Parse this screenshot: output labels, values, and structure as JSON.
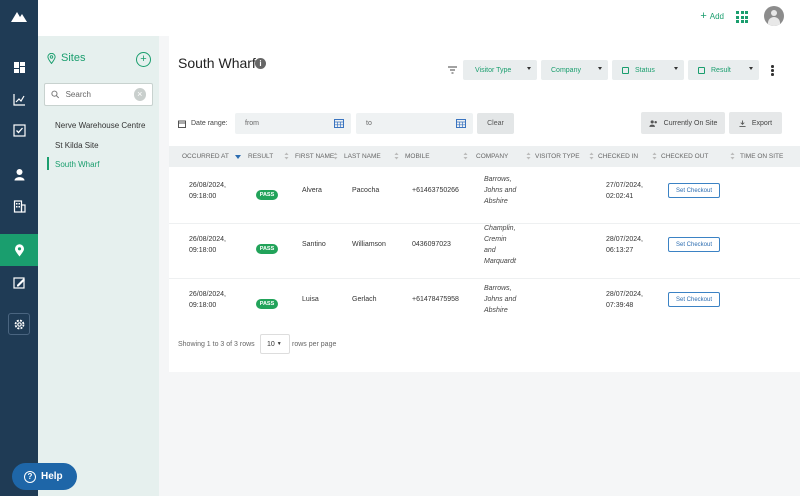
{
  "topbar": {
    "add_label": "Add"
  },
  "sites": {
    "title": "Sites",
    "search_placeholder": "Search",
    "items": [
      "Nerve Warehouse Centre",
      "St Kilda Site",
      "South Wharf"
    ],
    "active_item": "South Wharf"
  },
  "page": {
    "title": "South Wharf",
    "filters": [
      "Visitor Type",
      "Company",
      "Status",
      "Result"
    ],
    "date_range_label": "Date range:",
    "from_placeholder": "from",
    "to_placeholder": "to",
    "clear_label": "Clear",
    "currently_on_site_label": "Currently On Site",
    "export_label": "Export"
  },
  "table": {
    "columns": [
      "OCCURRED AT",
      "RESULT",
      "FIRST NAME",
      "LAST NAME",
      "MOBILE",
      "COMPANY",
      "VISITOR TYPE",
      "CHECKED IN",
      "CHECKED OUT",
      "TIME ON SITE"
    ],
    "rows": [
      {
        "occurred_at": [
          "26/08/2024,",
          "09:18:00"
        ],
        "result": "PASS",
        "first_name": "Alvera",
        "last_name": "Pacocha",
        "mobile": "+61463750266",
        "company": [
          "Barrows,",
          "Johns and",
          "Abshire"
        ],
        "visitor_type": "",
        "checked_in": [
          "27/07/2024,",
          "02:02:41"
        ],
        "checked_out": "Set Checkout",
        "time_on_site": ""
      },
      {
        "occurred_at": [
          "26/08/2024,",
          "09:18:00"
        ],
        "result": "PASS",
        "first_name": "Santino",
        "last_name": "Williamson",
        "mobile": "0436097023",
        "company": [
          "Champlin,",
          "Cremin",
          "and",
          "Marquardt"
        ],
        "visitor_type": "",
        "checked_in": [
          "28/07/2024,",
          "06:13:27"
        ],
        "checked_out": "Set Checkout",
        "time_on_site": ""
      },
      {
        "occurred_at": [
          "26/08/2024,",
          "09:18:00"
        ],
        "result": "PASS",
        "first_name": "Luisa",
        "last_name": "Gerlach",
        "mobile": "+61478475958",
        "company": [
          "Barrows,",
          "Johns and",
          "Abshire"
        ],
        "visitor_type": "",
        "checked_in": [
          "28/07/2024,",
          "07:39:48"
        ],
        "checked_out": "Set Checkout",
        "time_on_site": ""
      }
    ]
  },
  "pagination": {
    "showing_text": "Showing 1 to 3 of 3 rows",
    "page_size": "10",
    "rows_per_page_text": "rows per page"
  },
  "help": {
    "label": "Help"
  },
  "colors": {
    "brand_green": "#1a9e6e",
    "nav_dark": "#1f3b55",
    "pass_green": "#22a35a",
    "link_blue": "#2b6cb0",
    "help_blue": "#1e66a8"
  }
}
